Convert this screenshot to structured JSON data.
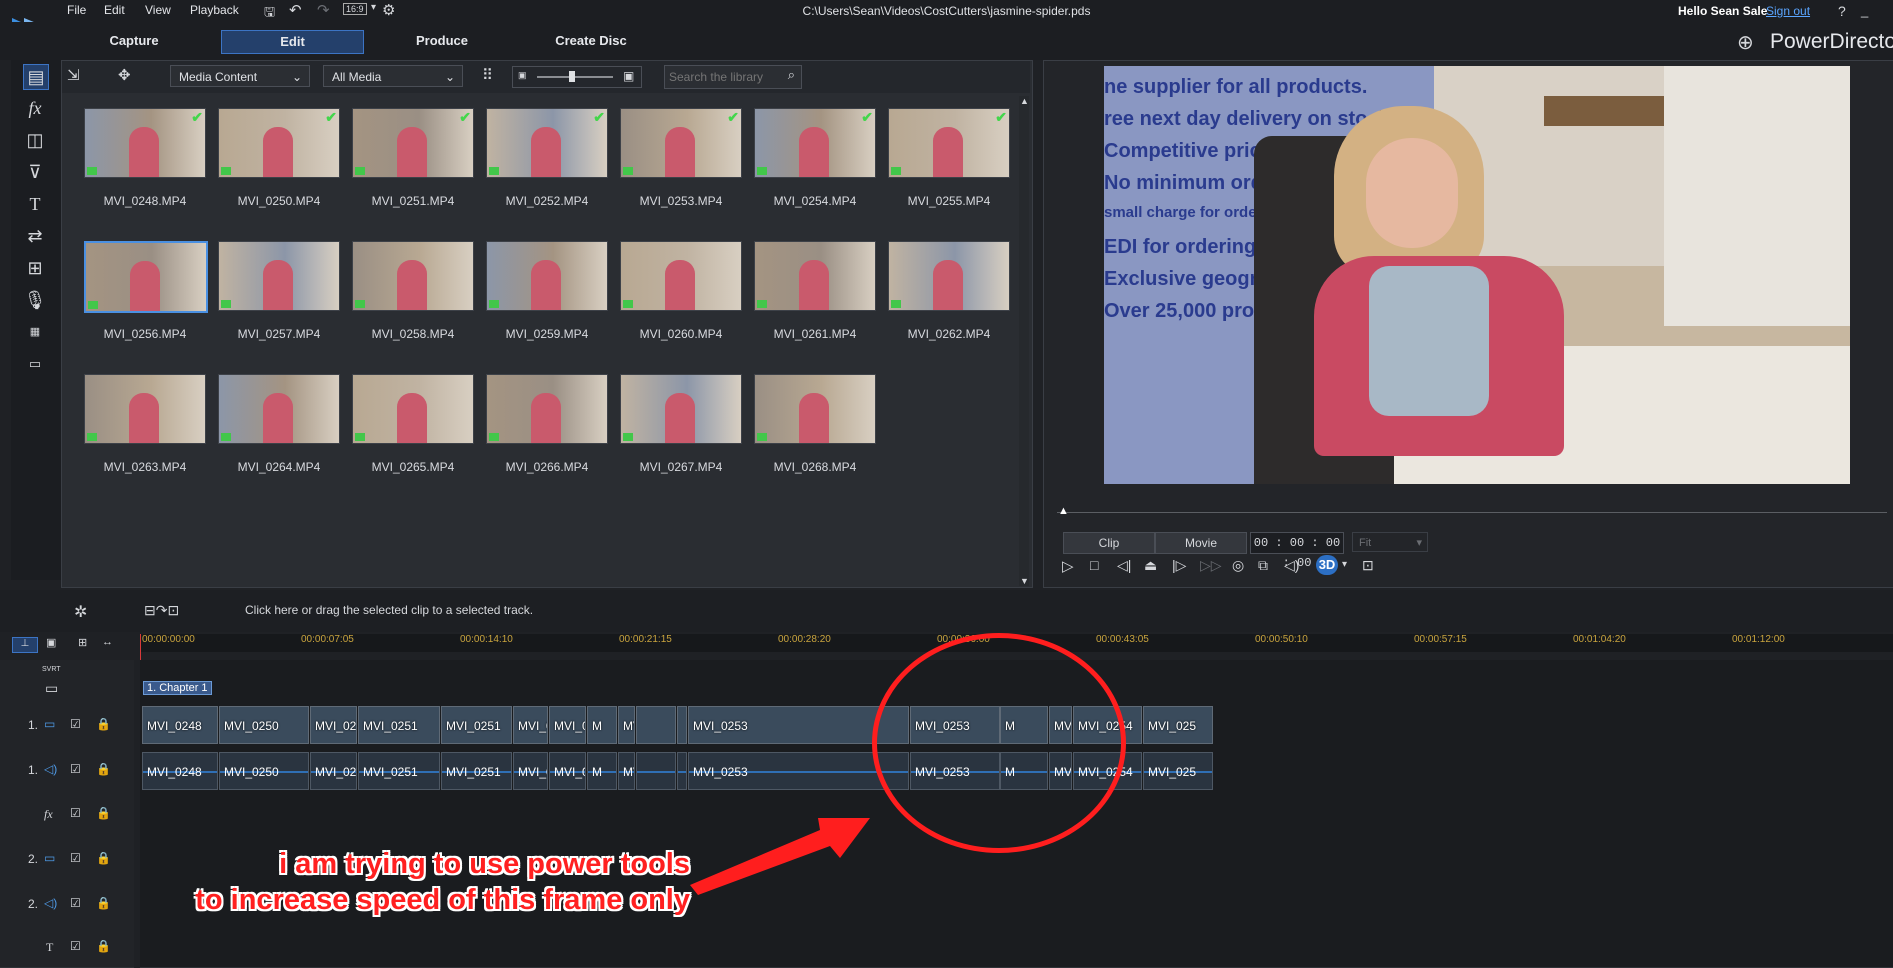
{
  "app": {
    "menu": [
      "File",
      "Edit",
      "View",
      "Playback"
    ],
    "aspect": "16:9",
    "file_path": "C:\\Users\\Sean\\Videos\\CostCutters\\jasmine-spider.pds",
    "greeting": "Hello Sean Sale",
    "signout": "Sign out",
    "help": "?",
    "brand": "PowerDirecto",
    "tabs": [
      "Capture",
      "Edit",
      "Produce",
      "Create Disc"
    ]
  },
  "library": {
    "dropdown_content": "Media Content",
    "dropdown_filter": "All Media",
    "search_placeholder": "Search the library",
    "items": [
      {
        "name": "MVI_0248.MP4",
        "checked": true
      },
      {
        "name": "MVI_0250.MP4",
        "checked": true
      },
      {
        "name": "MVI_0251.MP4",
        "checked": true
      },
      {
        "name": "MVI_0252.MP4",
        "checked": true
      },
      {
        "name": "MVI_0253.MP4",
        "checked": true
      },
      {
        "name": "MVI_0254.MP4",
        "checked": true
      },
      {
        "name": "MVI_0255.MP4",
        "checked": true
      },
      {
        "name": "MVI_0256.MP4",
        "checked": false
      },
      {
        "name": "MVI_0257.MP4",
        "checked": false
      },
      {
        "name": "MVI_0258.MP4",
        "checked": false
      },
      {
        "name": "MVI_0259.MP4",
        "checked": false
      },
      {
        "name": "MVI_0260.MP4",
        "checked": false
      },
      {
        "name": "MVI_0261.MP4",
        "checked": false
      },
      {
        "name": "MVI_0262.MP4",
        "checked": false
      },
      {
        "name": "MVI_0263.MP4",
        "checked": false
      },
      {
        "name": "MVI_0264.MP4",
        "checked": false
      },
      {
        "name": "MVI_0265.MP4",
        "checked": false
      },
      {
        "name": "MVI_0266.MP4",
        "checked": false
      },
      {
        "name": "MVI_0267.MP4",
        "checked": false
      },
      {
        "name": "MVI_0268.MP4",
        "checked": false
      }
    ]
  },
  "preview": {
    "poster_lines": [
      "ne supplier for all products.",
      "ree next day delivery on stocked lines",
      "Competitive prici",
      "No minimum orde",
      "small charge for orde",
      "EDI for ordering.",
      "Exclusive geograp",
      "Over 25,000 prod"
    ],
    "clip_btn": "Clip",
    "movie_btn": "Movie",
    "timecode": "00 : 00 : 00 : 00",
    "fit": "Fit",
    "badge_3d": "3D"
  },
  "timeline": {
    "hint": "Click here or drag the selected clip to a selected track.",
    "ruler_ticks": [
      "00:00:00:00",
      "00:00:07:05",
      "00:00:14:10",
      "00:00:21:15",
      "00:00:28:20",
      "00:00:36:00",
      "00:00:43:05",
      "00:00:50:10",
      "00:00:57:15",
      "00:01:04:20",
      "00:01:12:00"
    ],
    "svrt": "SVRT",
    "chapter": "1. Chapter 1",
    "track_labels": [
      "1.",
      "1.",
      "fx",
      "2.",
      "2.",
      "T"
    ],
    "video_clips": [
      "MVI_0248",
      "MVI_0250",
      "MVI_025",
      "MVI_0251",
      "MVI_0251",
      "MVI_0",
      "MVI_02",
      "M",
      "MV",
      "MVI_0253",
      "MVI_0253",
      "M",
      "MVI_025",
      "MVI_0254",
      "MVI_025"
    ],
    "audio_clips": [
      "MVI_0248",
      "MVI_0250",
      "MVI_025",
      "MVI_0251",
      "MVI_0251",
      "MVI_0",
      "MVI_02",
      "M",
      "MV",
      "MVI_0253",
      "MVI_0253",
      "M",
      "MVI_025",
      "MVI_0254",
      "MVI_025"
    ]
  },
  "annotation": {
    "line1": "i am trying to use power tools",
    "line2": "to increase speed of this frame only"
  },
  "colors": {
    "accent": "#3c74c4",
    "annotation_red": "#ff2020",
    "check_green": "#43d64b",
    "ruler_text": "#c9a43e"
  }
}
